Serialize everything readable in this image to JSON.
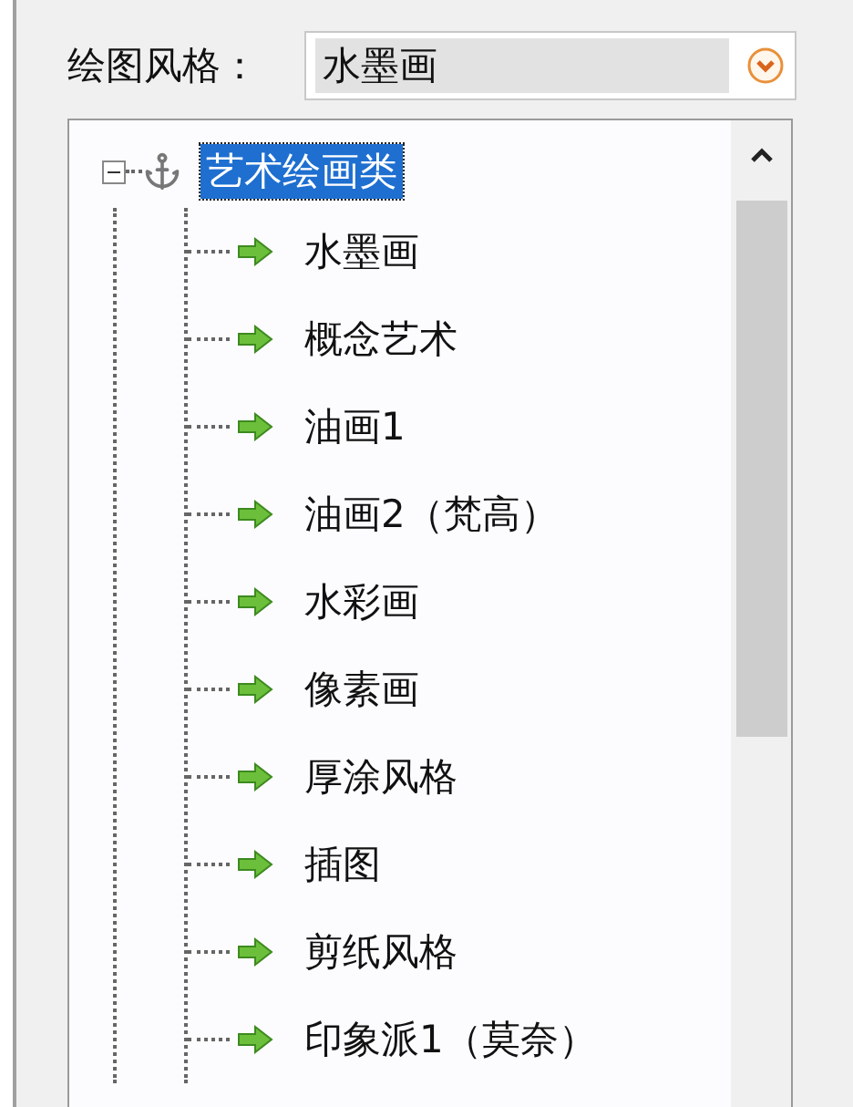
{
  "style_picker": {
    "label": "绘图风格：",
    "value": "水墨画"
  },
  "tree": [
    {
      "label": "艺术绘画类",
      "expanded": true,
      "selected": true,
      "children": [
        {
          "label": "水墨画",
          "selected": false
        },
        {
          "label": "概念艺术",
          "selected": false
        },
        {
          "label": "油画1",
          "selected": false
        },
        {
          "label": "油画2（梵高）",
          "selected": false
        },
        {
          "label": "水彩画",
          "selected": false
        },
        {
          "label": "像素画",
          "selected": false
        },
        {
          "label": "厚涂风格",
          "selected": false
        },
        {
          "label": "插图",
          "selected": false
        },
        {
          "label": "剪纸风格",
          "selected": false
        },
        {
          "label": "印象派1（莫奈）",
          "selected": false
        }
      ]
    }
  ]
}
